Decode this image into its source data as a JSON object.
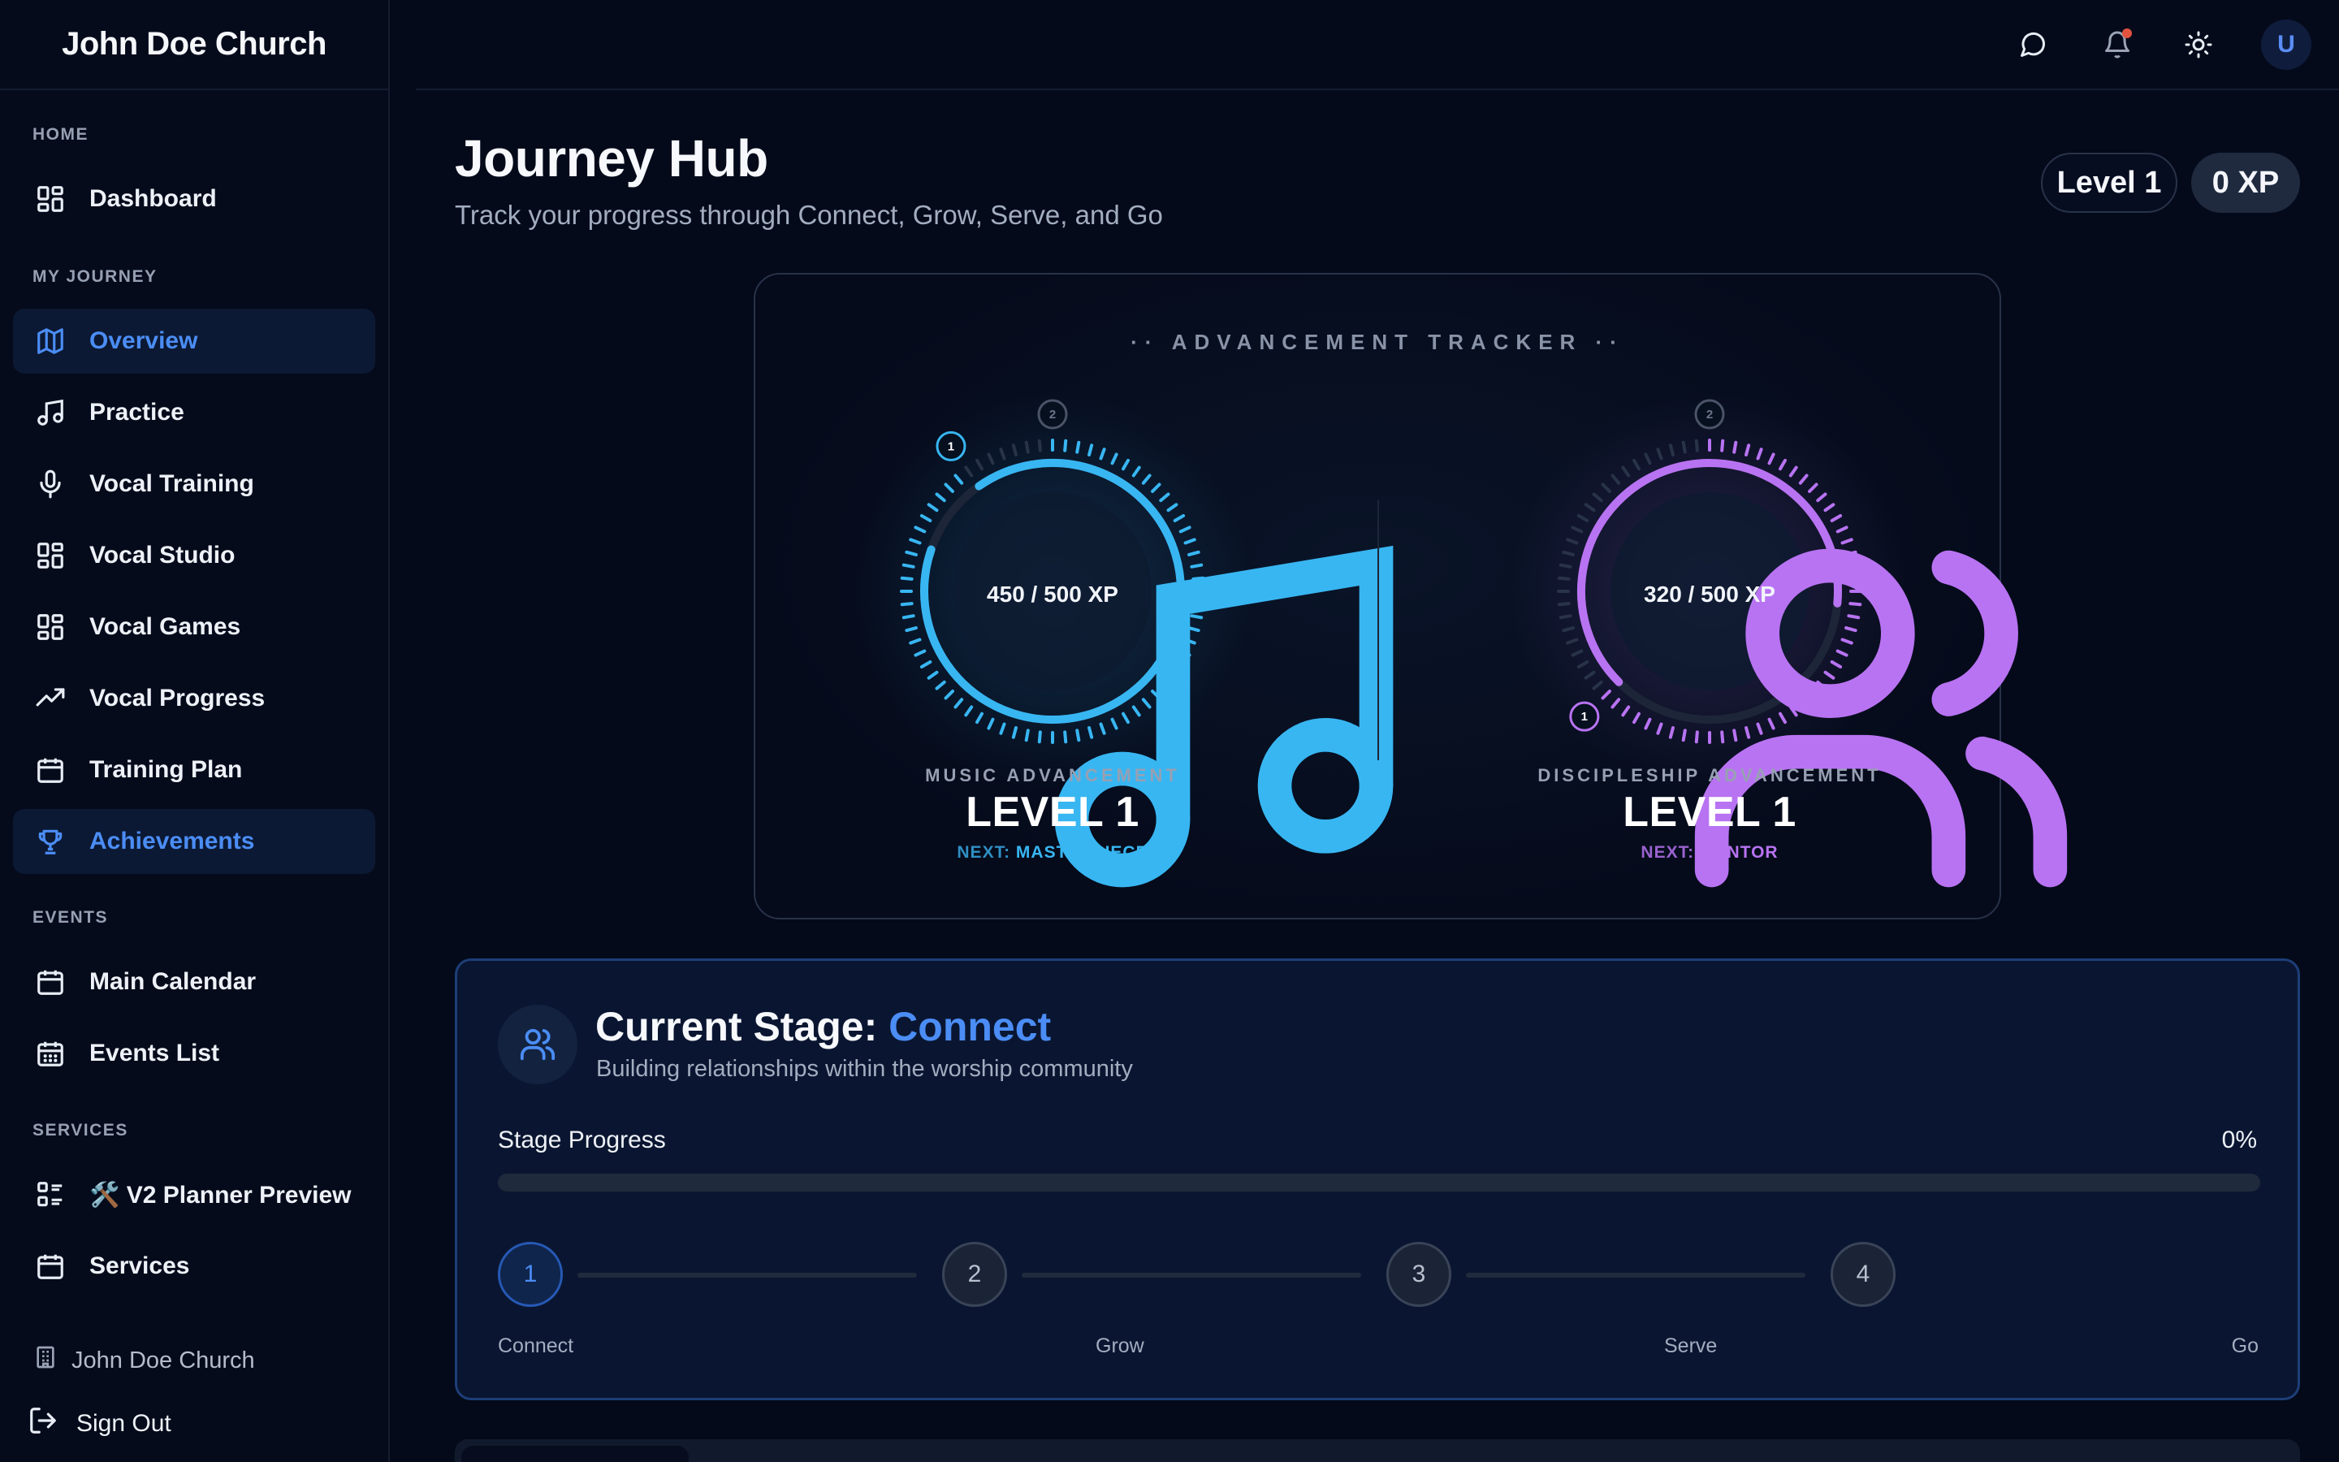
{
  "brand": "John Doe Church",
  "sidebar": {
    "sections": [
      {
        "label": "HOME"
      },
      {
        "label": "MY JOURNEY"
      },
      {
        "label": "EVENTS"
      },
      {
        "label": "SERVICES"
      }
    ],
    "items": [
      {
        "label": "Dashboard",
        "icon": "dashboard-grid-icon",
        "active": false
      },
      {
        "label": "Overview",
        "icon": "map-icon",
        "active": true
      },
      {
        "label": "Practice",
        "icon": "music-note-icon",
        "active": false
      },
      {
        "label": "Vocal Training",
        "icon": "microphone-icon",
        "active": false
      },
      {
        "label": "Vocal Studio",
        "icon": "grid-icon",
        "active": false
      },
      {
        "label": "Vocal Games",
        "icon": "grid-icon",
        "active": false
      },
      {
        "label": "Vocal Progress",
        "icon": "trending-up-icon",
        "active": false
      },
      {
        "label": "Training Plan",
        "icon": "calendar-icon",
        "active": false
      },
      {
        "label": "Achievements",
        "icon": "trophy-icon",
        "active": true
      },
      {
        "label": "Main Calendar",
        "icon": "calendar-icon",
        "active": false
      },
      {
        "label": "Events List",
        "icon": "calendar-grid-icon",
        "active": false
      },
      {
        "label": "🛠️ V2 Planner Preview",
        "icon": "list-icon",
        "active": false
      },
      {
        "label": "Services",
        "icon": "calendar-icon",
        "active": false
      }
    ],
    "footer": {
      "org": "John Doe Church",
      "sign_out": "Sign Out"
    }
  },
  "topbar": {
    "icons": [
      "chat-icon",
      "bell-icon",
      "sun-icon"
    ],
    "avatar_initial": "U"
  },
  "header": {
    "title": "Journey Hub",
    "subtitle": "Track your progress through Connect, Grow, Serve, and Go",
    "level_pill": "Level 1",
    "xp_pill": "0 XP"
  },
  "tracker": {
    "title": "·· ADVANCEMENT TRACKER ··",
    "dials": [
      {
        "label": "MUSIC ADVANCEMENT",
        "xp_text": "450 / 500 XP",
        "xp": 450,
        "xp_max": 500,
        "level": "LEVEL 1",
        "next_prefix": "NEXT:",
        "next_value": "MASTERPIECE",
        "color": "#38b6f2",
        "icon": "music-note-icon",
        "marker_start": "1",
        "marker_end": "2"
      },
      {
        "label": "DISCIPLESHIP ADVANCEMENT",
        "xp_text": "320 / 500 XP",
        "xp": 320,
        "xp_max": 500,
        "level": "LEVEL 1",
        "next_prefix": "NEXT:",
        "next_value": "MENTOR",
        "color": "#b873f2",
        "icon": "users-icon",
        "marker_start": "1",
        "marker_end": "2"
      }
    ]
  },
  "stage": {
    "title_prefix": "Current Stage: ",
    "title_stage": "Connect",
    "subtitle": "Building relationships within the worship community",
    "progress_label": "Stage Progress",
    "progress_value": "0%",
    "progress_fraction": 0,
    "steps": [
      {
        "num": "1",
        "label": "Connect",
        "active": true
      },
      {
        "num": "2",
        "label": "Grow",
        "active": false
      },
      {
        "num": "3",
        "label": "Serve",
        "active": false
      },
      {
        "num": "4",
        "label": "Go",
        "active": false
      }
    ]
  },
  "colors": {
    "accent": "#4b8df5",
    "music": "#38b6f2",
    "discipleship": "#b873f2",
    "background": "#040a1a"
  }
}
